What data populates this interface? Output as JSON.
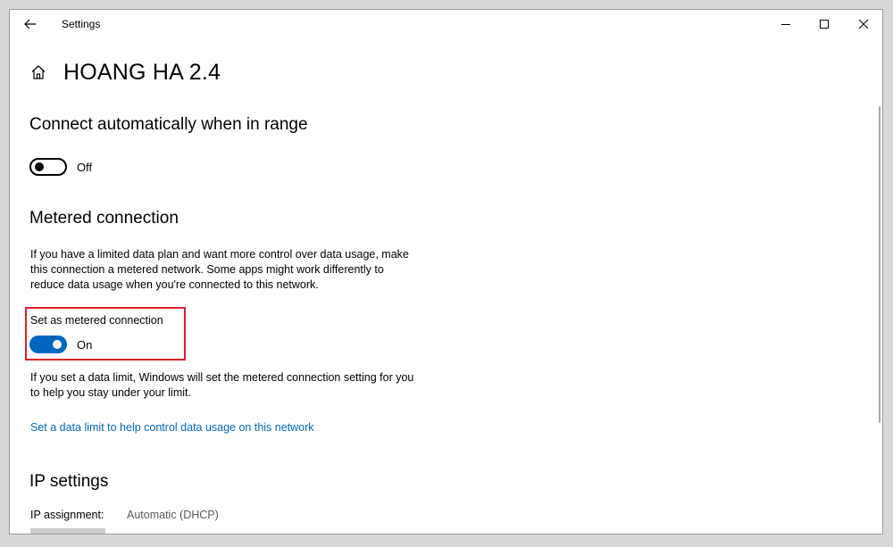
{
  "window": {
    "app_title": "Settings"
  },
  "page": {
    "title": "HOANG HA 2.4"
  },
  "connect_auto": {
    "heading": "Connect automatically when in range",
    "toggle_state": "Off"
  },
  "metered": {
    "heading": "Metered connection",
    "description": "If you have a limited data plan and want more control over data usage, make this connection a metered network. Some apps might work differently to reduce data usage when you're connected to this network.",
    "setting_label": "Set as metered connection",
    "toggle_state": "On",
    "limit_note": "If you set a data limit, Windows will set the metered connection setting for you to help you stay under your limit.",
    "link_text": "Set a data limit to help control data usage on this network"
  },
  "ip_settings": {
    "heading": "IP settings",
    "assignment_label": "IP assignment:",
    "assignment_value": "Automatic (DHCP)"
  },
  "colors": {
    "accent": "#0067c0",
    "highlight": "#e0202a"
  },
  "icons": {
    "back": "back-arrow-icon",
    "home": "home-icon",
    "minimize": "minimize-icon",
    "maximize": "maximize-icon",
    "close": "close-icon"
  }
}
